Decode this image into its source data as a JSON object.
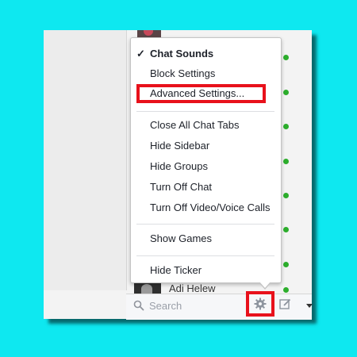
{
  "menu": {
    "items": [
      {
        "label": "Chat Sounds",
        "checked": true
      },
      {
        "label": "Block Settings"
      },
      {
        "label": "Advanced Settings..."
      },
      {
        "label": "Close All Chat Tabs"
      },
      {
        "label": "Hide Sidebar"
      },
      {
        "label": "Hide Groups"
      },
      {
        "label": "Turn Off Chat"
      },
      {
        "label": "Turn Off Video/Voice Calls"
      },
      {
        "label": "Show Games"
      },
      {
        "label": "Hide Ticker"
      }
    ],
    "check_glyph": "✓",
    "highlighted_item": "Advanced Settings..."
  },
  "sidebar": {
    "friend_name": "Adi Helew",
    "online_color": "#2cae2c"
  },
  "bottom_bar": {
    "search_placeholder": "Search",
    "gear_icon": "gear-icon",
    "compose_icon": "compose-icon"
  },
  "colors": {
    "background": "#0ee8f0",
    "highlight": "#e8111b"
  }
}
